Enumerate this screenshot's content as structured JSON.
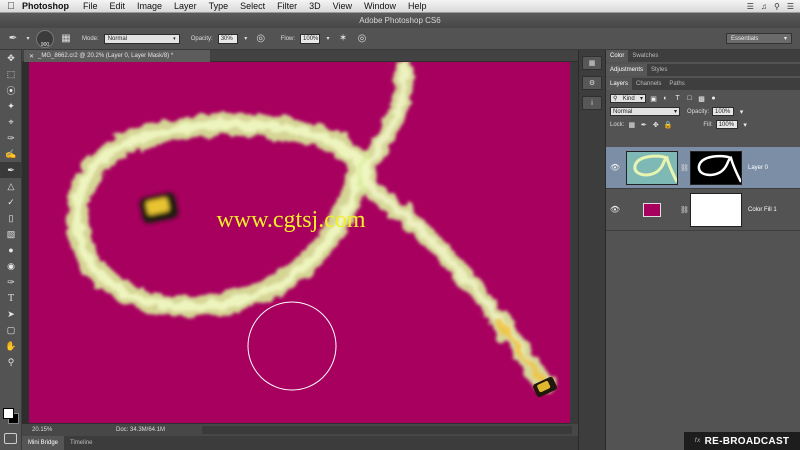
{
  "menubar": {
    "app": "Photoshop",
    "menus": [
      "File",
      "Edit",
      "Image",
      "Layer",
      "Type",
      "Select",
      "Filter",
      "3D",
      "View",
      "Window",
      "Help"
    ]
  },
  "titlebar": {
    "title": "Adobe Photoshop CS6"
  },
  "options": {
    "brush_size": "900",
    "mode_label": "Mode:",
    "mode_value": "Normal",
    "opacity_label": "Opacity:",
    "opacity_value": "30%",
    "flow_label": "Flow:",
    "flow_value": "100%",
    "workspace": "Essentials"
  },
  "document": {
    "tab_title": "_MG_8662.cr2 @ 20.2% (Layer 0, Layer Mask/8) *",
    "canvas_color": "#a7005f",
    "watermark_text": "www.cgtsj.com",
    "zoom": "20.15%",
    "doc_info": "Doc: 34.3M/64.1M"
  },
  "bottom_tabs": [
    "Mini Bridge",
    "Timeline"
  ],
  "panels": {
    "group1_tabs": [
      "Color",
      "Swatches"
    ],
    "group2_tabs": [
      "Adjustments",
      "Styles"
    ],
    "group3_tabs": [
      "Layers",
      "Channels",
      "Paths"
    ],
    "filter_kind": "Kind",
    "blend_mode": "Normal",
    "opacity_label": "Opacity:",
    "opacity_value": "100%",
    "lock_label": "Lock:",
    "fill_label": "Fill:",
    "fill_value": "100%",
    "layers": [
      {
        "name": "Layer 0",
        "selected": true
      },
      {
        "name": "Color Fill 1",
        "selected": false
      }
    ]
  },
  "overlay": {
    "rebroadcast": "RE-BROADCAST"
  }
}
